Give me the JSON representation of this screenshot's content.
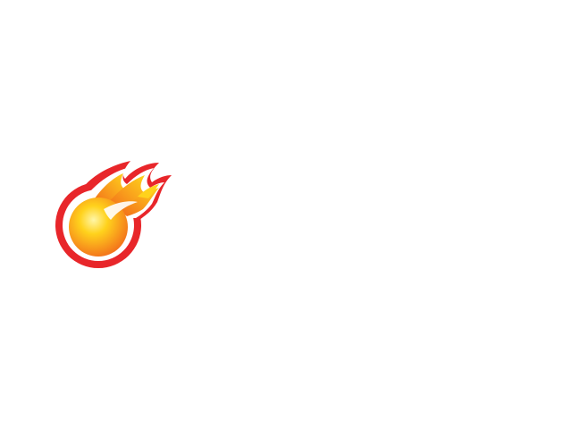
{
  "logo": {
    "icon": "fireball-icon",
    "colors": {
      "outline_red": "#e8262a",
      "ring_white": "#ffffff",
      "flame_orange": "#f26a1b",
      "flame_yellow": "#ffd21c",
      "core_highlight": "#fff6a8"
    }
  }
}
